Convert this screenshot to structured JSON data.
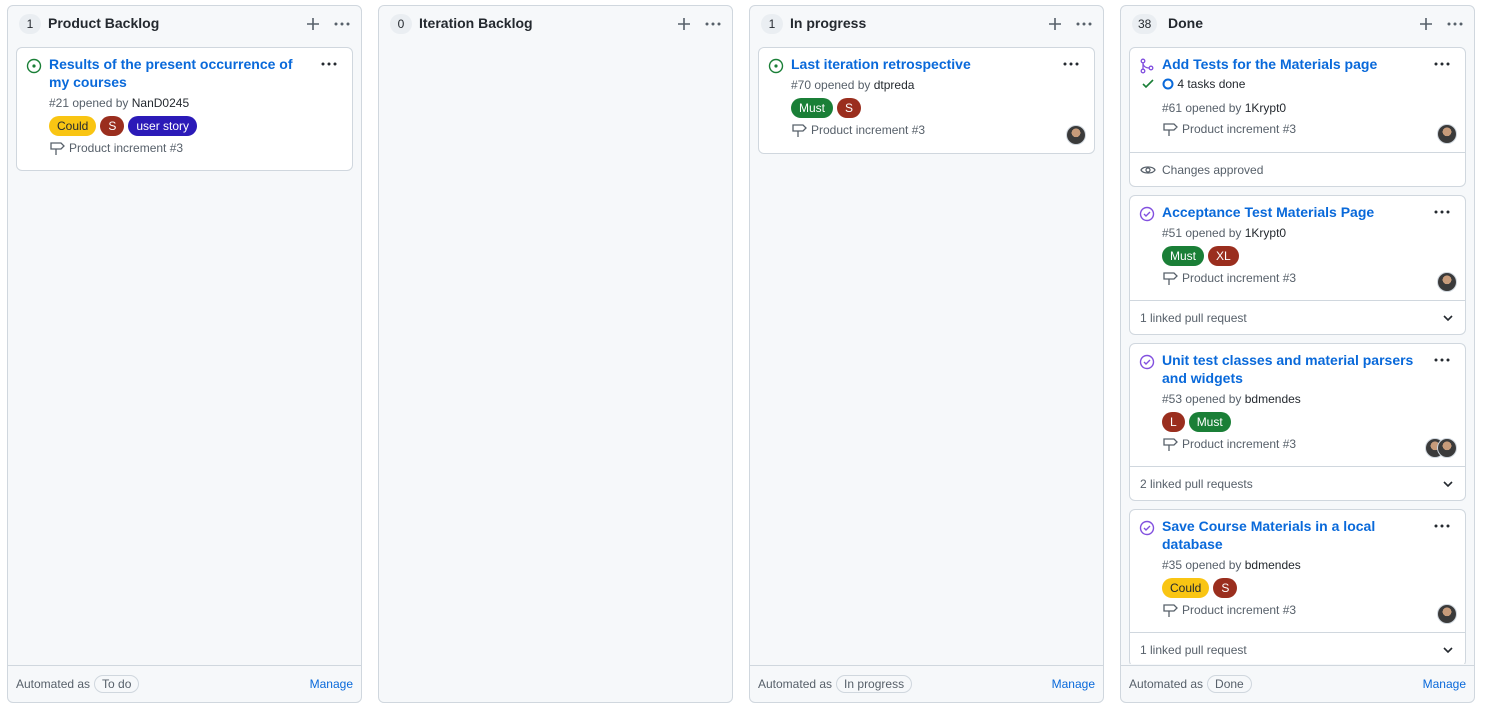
{
  "columns": [
    {
      "count": "1",
      "title": "Product Backlog",
      "automation_prefix": "Automated as",
      "automation_value": "To do",
      "manage_label": "Manage",
      "cards": [
        {
          "state": "issue-open",
          "title": "Results of the present occurrence of my courses",
          "number_opened": "#21 opened by",
          "author": "NanD0245",
          "labels": [
            {
              "text": "Could",
              "bg": "#f9c513",
              "fg": "#24292f"
            },
            {
              "text": "S",
              "bg": "#9a2e1e",
              "fg": "#ffffff"
            },
            {
              "text": "user story",
              "bg": "#2b1ab8",
              "fg": "#ffffff"
            }
          ],
          "milestone": "Product increment #3"
        }
      ]
    },
    {
      "count": "0",
      "title": "Iteration Backlog",
      "cards": []
    },
    {
      "count": "1",
      "title": "In progress",
      "automation_prefix": "Automated as",
      "automation_value": "In progress",
      "manage_label": "Manage",
      "cards": [
        {
          "state": "issue-open",
          "title": "Last iteration retrospective",
          "number_opened": "#70 opened by",
          "author": "dtpreda",
          "labels": [
            {
              "text": "Must",
              "bg": "#1a7f37",
              "fg": "#ffffff"
            },
            {
              "text": "S",
              "bg": "#9a2e1e",
              "fg": "#ffffff"
            }
          ],
          "milestone": "Product increment #3",
          "avatars": 1
        }
      ]
    },
    {
      "count": "38",
      "title": "Done",
      "automation_prefix": "Automated as",
      "automation_value": "Done",
      "manage_label": "Manage",
      "cards": [
        {
          "state": "pr-merged",
          "title": "Add Tests for the Materials page",
          "tasks": "4 tasks done",
          "number_opened": "#61 opened by",
          "author": "1Krypt0",
          "labels": [],
          "milestone": "Product increment #3",
          "avatars": 1,
          "footer": "Changes approved",
          "footer_type": "review"
        },
        {
          "state": "issue-closed",
          "title": "Acceptance Test Materials Page",
          "number_opened": "#51 opened by",
          "author": "1Krypt0",
          "labels": [
            {
              "text": "Must",
              "bg": "#1a7f37",
              "fg": "#ffffff"
            },
            {
              "text": "XL",
              "bg": "#9a2e1e",
              "fg": "#ffffff"
            }
          ],
          "milestone": "Product increment #3",
          "avatars": 1,
          "footer": "1 linked pull request",
          "footer_type": "linked"
        },
        {
          "state": "issue-closed",
          "title": "Unit test classes and material parsers and widgets",
          "number_opened": "#53 opened by",
          "author": "bdmendes",
          "labels": [
            {
              "text": "L",
              "bg": "#9a2e1e",
              "fg": "#ffffff"
            },
            {
              "text": "Must",
              "bg": "#1a7f37",
              "fg": "#ffffff"
            }
          ],
          "milestone": "Product increment #3",
          "avatars": 2,
          "footer": "2 linked pull requests",
          "footer_type": "linked"
        },
        {
          "state": "issue-closed",
          "title": "Save Course Materials in a local database",
          "number_opened": "#35 opened by",
          "author": "bdmendes",
          "labels": [
            {
              "text": "Could",
              "bg": "#f9c513",
              "fg": "#24292f"
            },
            {
              "text": "S",
              "bg": "#9a2e1e",
              "fg": "#ffffff"
            }
          ],
          "milestone": "Product increment #3",
          "avatars": 1,
          "footer": "1 linked pull request",
          "footer_type": "linked"
        }
      ]
    }
  ]
}
